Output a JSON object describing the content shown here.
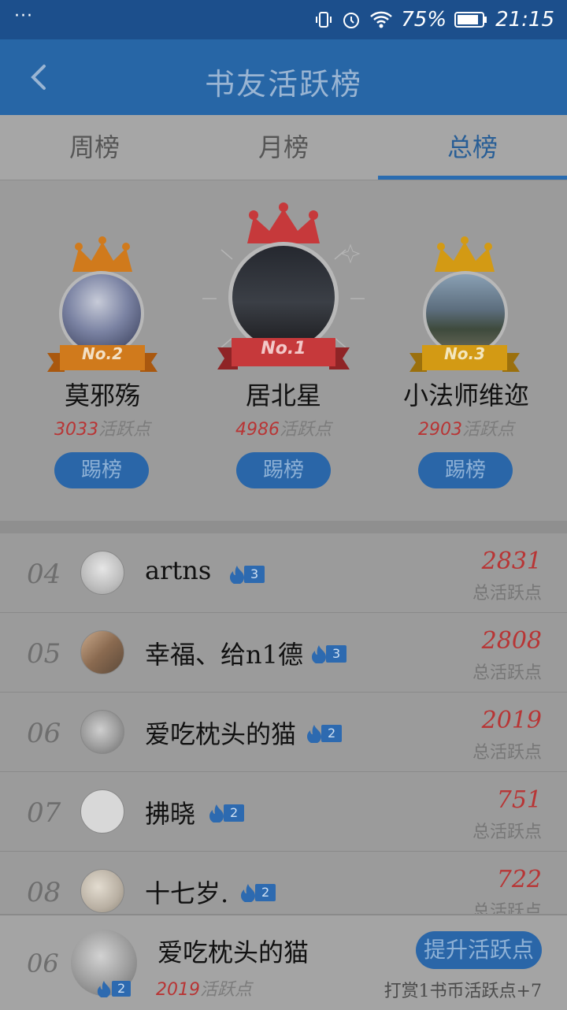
{
  "status_bar": {
    "menu": "···",
    "battery": "75%",
    "time": "21:15",
    "icons": [
      "vibrate-icon",
      "alarm-icon",
      "wifi-icon",
      "battery-icon"
    ]
  },
  "header": {
    "title": "书友活跃榜",
    "back_icon": "back-arrow-icon"
  },
  "tabs": [
    {
      "label": "周榜",
      "active": false
    },
    {
      "label": "月榜",
      "active": false
    },
    {
      "label": "总榜",
      "active": true
    }
  ],
  "podium": [
    {
      "badge": "No.2",
      "name": "莫邪殇",
      "score": "3033",
      "unit": "活跃点",
      "button": "踢榜"
    },
    {
      "badge": "No.1",
      "name": "居北星",
      "score": "4986",
      "unit": "活跃点",
      "button": "踢榜"
    },
    {
      "badge": "No.3",
      "name": "小法师维迩",
      "score": "2903",
      "unit": "活跃点",
      "button": "踢榜"
    }
  ],
  "list": [
    {
      "rank": "04",
      "name": "artns",
      "level": "3",
      "score": "2831",
      "unit": "总活跃点"
    },
    {
      "rank": "05",
      "name": "幸福、给n1德",
      "level": "3",
      "score": "2808",
      "unit": "总活跃点"
    },
    {
      "rank": "06",
      "name": "爱吃枕头的猫",
      "level": "2",
      "score": "2019",
      "unit": "总活跃点"
    },
    {
      "rank": "07",
      "name": "拂晓",
      "level": "2",
      "score": "751",
      "unit": "总活跃点"
    },
    {
      "rank": "08",
      "name": "十七岁.",
      "level": "2",
      "score": "722",
      "unit": "总活跃点"
    }
  ],
  "my_rank": {
    "rank": "06",
    "name": "爱吃枕头的猫",
    "level": "2",
    "score": "2019",
    "unit": "活跃点",
    "button": "提升活跃点",
    "tip": "打赏1书币活跃点+7"
  },
  "colors": {
    "header": "#2766a6",
    "accent": "#2a66a8",
    "score_red": "#b83535",
    "gold_1": "#c6393b",
    "silver_2": "#d07a1c",
    "bronze_3": "#d39a14"
  }
}
